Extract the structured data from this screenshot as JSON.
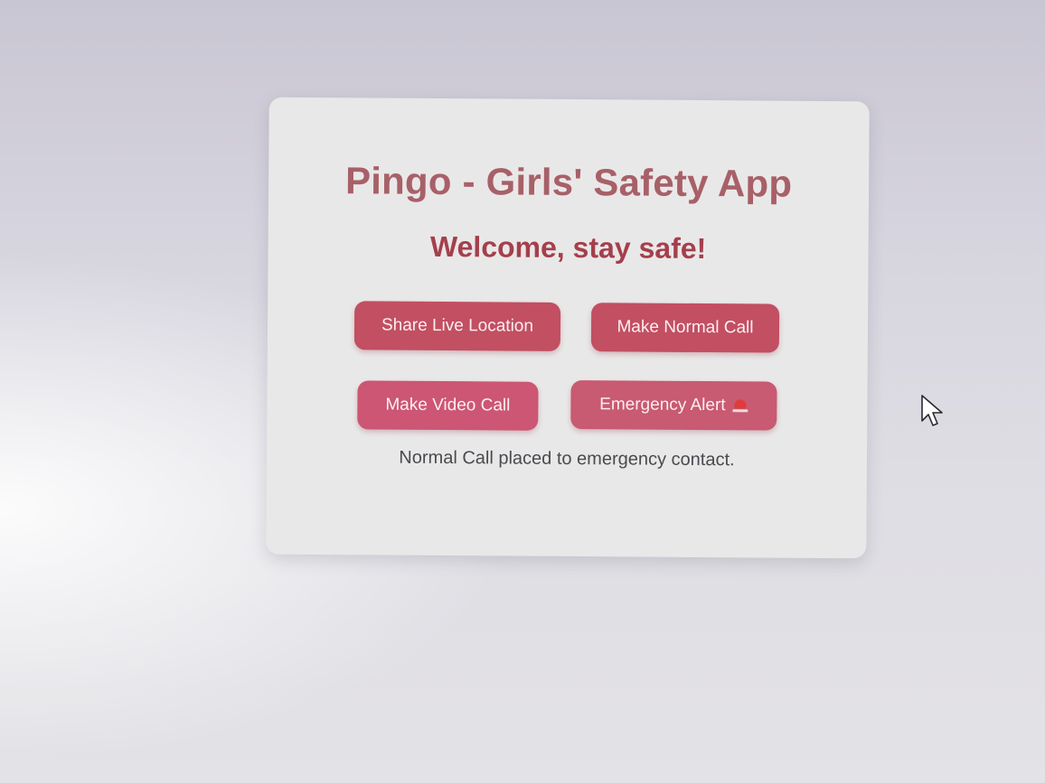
{
  "app": {
    "title": "Pingo - Girls' Safety App",
    "subtitle": "Welcome, stay safe!"
  },
  "buttons": {
    "share_location": "Share Live Location",
    "normal_call": "Make Normal Call",
    "video_call": "Make Video Call",
    "emergency_alert": "Emergency Alert"
  },
  "status": {
    "message": "Normal Call placed to emergency contact."
  },
  "icons": {
    "emergency_alert": "siren-icon",
    "pointer": "mouse-cursor-icon"
  },
  "colors": {
    "title": "#a86068",
    "subtitle": "#a53f4c",
    "button": "#c24f62",
    "card_background": "#e9e8e8"
  }
}
